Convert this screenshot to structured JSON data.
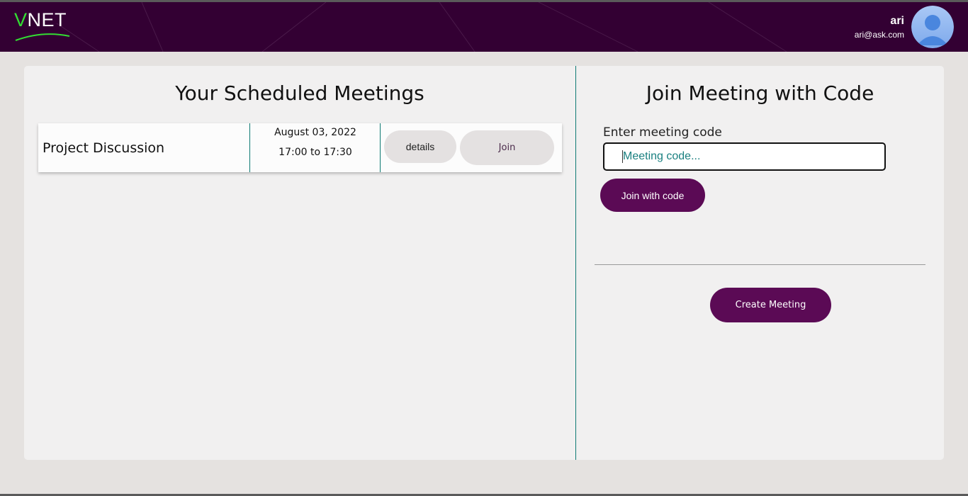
{
  "header": {
    "logo_text_v": "V",
    "logo_text_rest": "NET",
    "user_name": "ari",
    "user_email": "ari@ask.com"
  },
  "scheduled": {
    "title": "Your Scheduled Meetings",
    "meetings": [
      {
        "name": "Project Discussion",
        "date": "August 03, 2022",
        "time": "17:00 to 17:30",
        "details_label": "details",
        "join_label": "Join"
      }
    ]
  },
  "join_code": {
    "title": "Join Meeting with Code",
    "label": "Enter meeting code",
    "placeholder": "Meeting code...",
    "button_label": "Join with code"
  },
  "create": {
    "button_label": "Create Meeting"
  },
  "colors": {
    "header_bg": "#330033",
    "accent": "#5b0a55",
    "teal": "#0e7a73",
    "logo_green": "#33dd33"
  }
}
